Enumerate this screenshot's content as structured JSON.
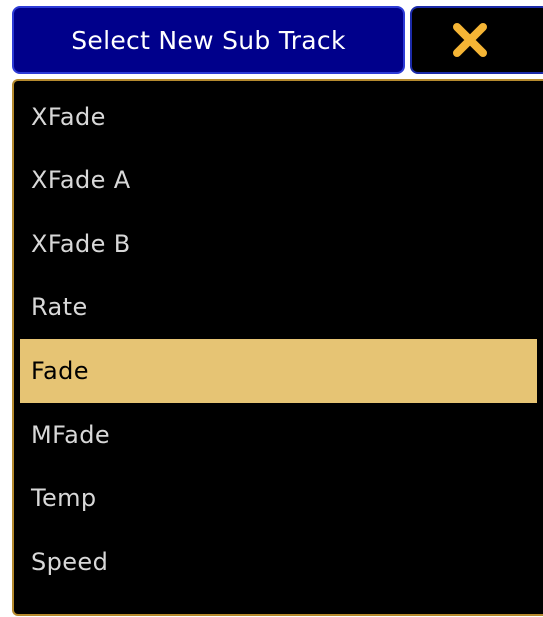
{
  "dialog": {
    "title": "Select New Sub Track",
    "close_icon": "close-x-icon"
  },
  "colors": {
    "title_bg": "#00008b",
    "selected_bg": "#e6c474",
    "close_icon": "#f5b535",
    "panel_border": "#b58a2e"
  },
  "list": {
    "items": [
      {
        "label": "XFade"
      },
      {
        "label": "XFade A"
      },
      {
        "label": "XFade B"
      },
      {
        "label": "Rate"
      },
      {
        "label": "Fade"
      },
      {
        "label": "MFade"
      },
      {
        "label": "Temp"
      },
      {
        "label": "Speed"
      }
    ],
    "selected_index": 4
  }
}
